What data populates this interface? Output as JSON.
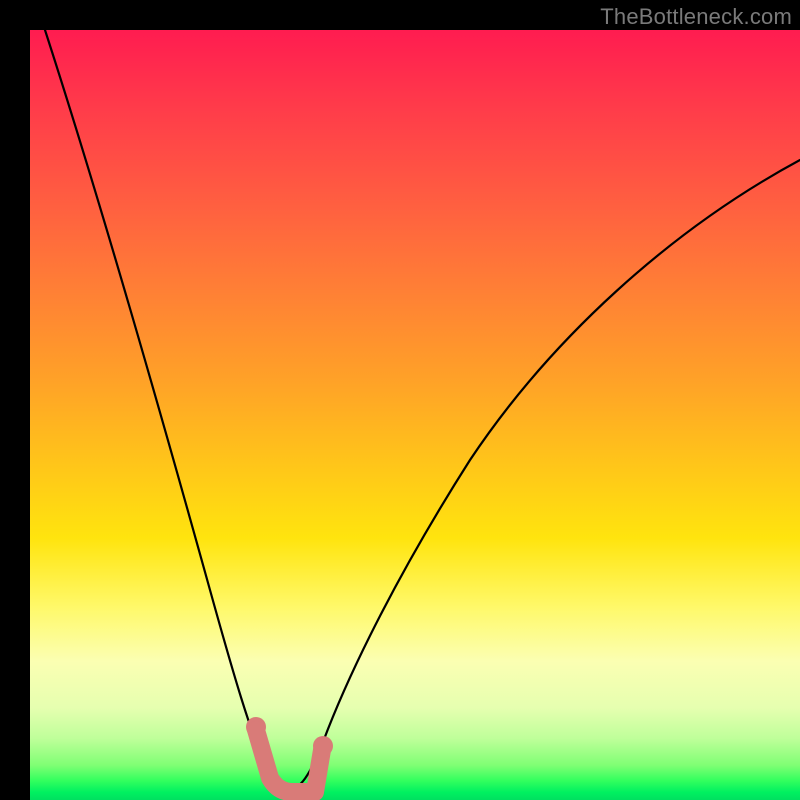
{
  "watermark": "TheBottleneck.com",
  "chart_data": {
    "type": "line",
    "title": "",
    "xlabel": "",
    "ylabel": "",
    "xlim": [
      0,
      100
    ],
    "ylim": [
      0,
      100
    ],
    "background": "red-yellow-green vertical gradient (red top, green bottom)",
    "series": [
      {
        "name": "bottleneck-curve",
        "x": [
          0,
          5,
          10,
          15,
          20,
          24,
          27,
          29,
          31,
          33,
          35,
          37,
          40,
          45,
          50,
          55,
          60,
          65,
          70,
          75,
          80,
          85,
          90,
          95,
          100
        ],
        "y": [
          100,
          83,
          66,
          49,
          32,
          18,
          9,
          4,
          1,
          0,
          1,
          3,
          8,
          16,
          25,
          33,
          40,
          46,
          52,
          57,
          62,
          67,
          71,
          75,
          79
        ]
      }
    ],
    "annotations": [
      {
        "name": "optimal-range-marker",
        "color": "#d97b78",
        "x_range": [
          28,
          37
        ],
        "y_range": [
          0,
          9
        ]
      }
    ],
    "legend": false,
    "grid": false
  }
}
